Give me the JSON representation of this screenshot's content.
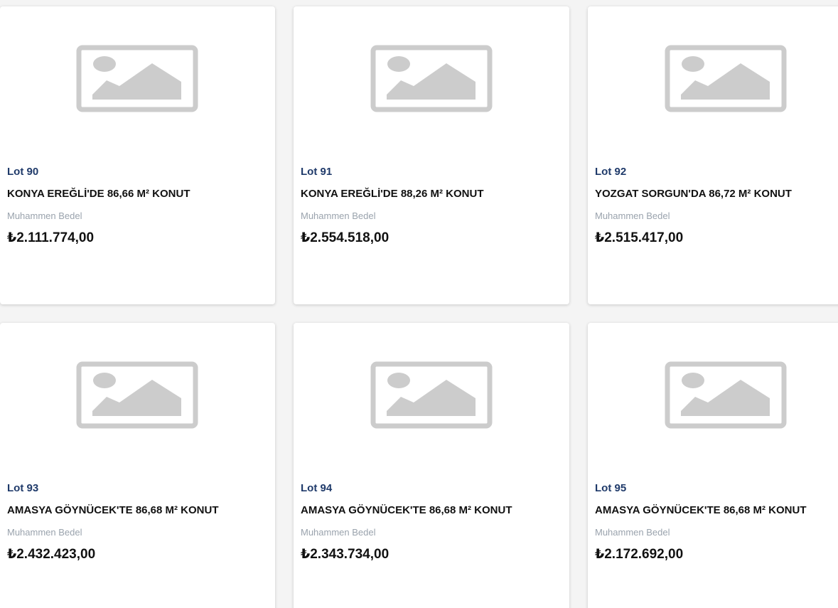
{
  "colors": {
    "lot_label": "#1f3a6a",
    "placeholder_gray": "#cccccc",
    "muted_label": "#9aa3ad",
    "page_bg": "#f4f4f4",
    "card_bg": "#ffffff"
  },
  "listings": [
    {
      "lot": "Lot 90",
      "title": "KONYA EREĞLİ'DE 86,66 M² KONUT",
      "price_label": "Muhammen Bedel",
      "price": "₺2.111.774,00",
      "image_icon": "image-placeholder-icon"
    },
    {
      "lot": "Lot 91",
      "title": "KONYA EREĞLİ'DE 88,26 M² KONUT",
      "price_label": "Muhammen Bedel",
      "price": "₺2.554.518,00",
      "image_icon": "image-placeholder-icon"
    },
    {
      "lot": "Lot 92",
      "title": "YOZGAT SORGUN'DA 86,72 M² KONUT",
      "price_label": "Muhammen Bedel",
      "price": "₺2.515.417,00",
      "image_icon": "image-placeholder-icon"
    },
    {
      "lot": "Lot 93",
      "title": "AMASYA GÖYNÜCEK'TE 86,68 M² KONUT",
      "price_label": "Muhammen Bedel",
      "price": "₺2.432.423,00",
      "image_icon": "image-placeholder-icon"
    },
    {
      "lot": "Lot 94",
      "title": "AMASYA GÖYNÜCEK'TE 86,68 M² KONUT",
      "price_label": "Muhammen Bedel",
      "price": "₺2.343.734,00",
      "image_icon": "image-placeholder-icon"
    },
    {
      "lot": "Lot 95",
      "title": "AMASYA GÖYNÜCEK'TE 86,68 M² KONUT",
      "price_label": "Muhammen Bedel",
      "price": "₺2.172.692,00",
      "image_icon": "image-placeholder-icon"
    }
  ]
}
